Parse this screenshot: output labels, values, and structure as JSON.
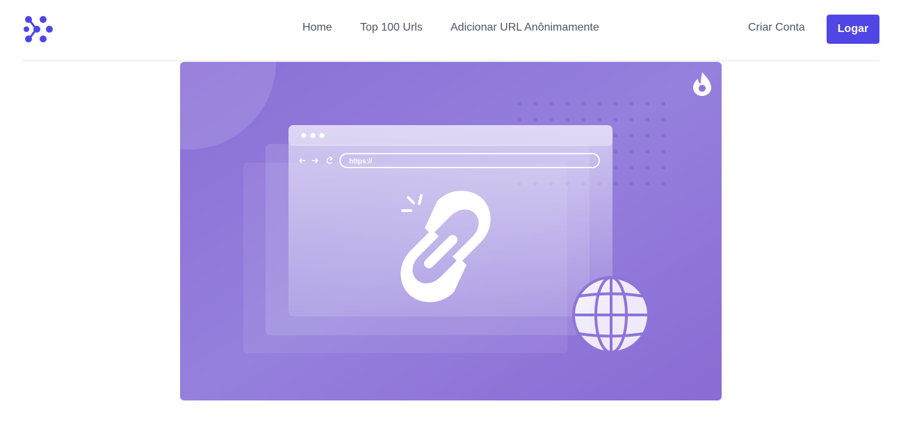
{
  "header": {
    "logo_icon": "molecule-logo-icon",
    "nav": [
      {
        "label": "Home"
      },
      {
        "label": "Top 100 Urls"
      },
      {
        "label": "Adicionar URL Anônimamente"
      }
    ],
    "create_account_label": "Criar Conta",
    "login_label": "Logar"
  },
  "hero": {
    "address_bar_text": "https://",
    "icons": [
      "flame-icon",
      "chain-link-icon",
      "globe-icon",
      "back-arrow-icon",
      "forward-arrow-icon",
      "refresh-icon"
    ]
  },
  "colors": {
    "accent": "#4f46e5",
    "hero_purple": "#8f73d8",
    "nav_text": "#4b5563"
  }
}
